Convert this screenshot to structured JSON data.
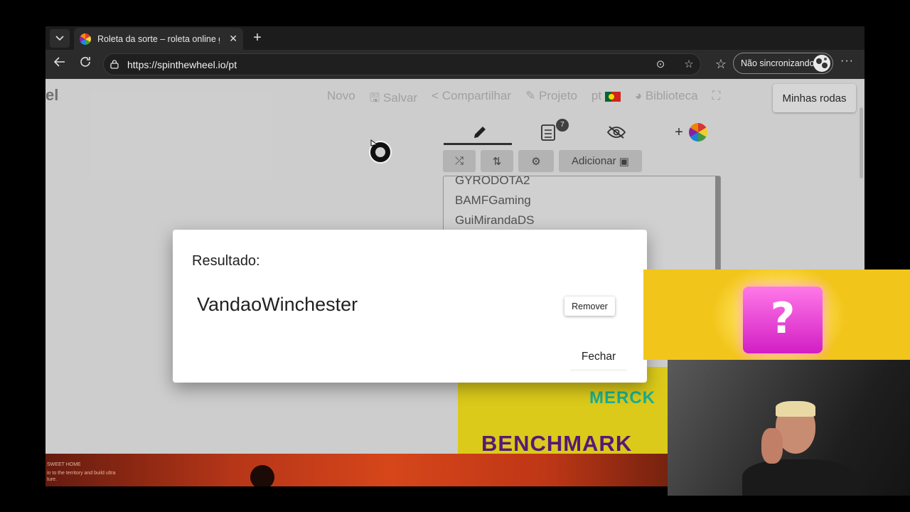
{
  "browser": {
    "tab_title": "Roleta da sorte – roleta online g",
    "url": "https://spinthewheel.io/pt",
    "sync_label": "Não sincronizando"
  },
  "site": {
    "logo_fragment": "el",
    "menu": {
      "novo": "Novo",
      "salvar": "Salvar",
      "compartilhar": "Compartilhar",
      "projeto": "Projeto",
      "lang": "pt",
      "biblioteca": "Biblioteca",
      "minhas_rodas": "Minhas rodas"
    },
    "entries_badge": "7",
    "add_image_label": "Adicionar",
    "entries": [
      "GYRODOTA2",
      "BAMFGaming",
      "GuiMirandaDS"
    ],
    "wheel_labels": [
      "MERCK",
      "BENCHMARK"
    ]
  },
  "stream_strip": {
    "lines": [
      "SWEET HOME",
      "in to the territory and build ultra",
      "ture."
    ]
  },
  "modal": {
    "title": "Resultado:",
    "winner": "VandaoWinchester",
    "remove_label": "Remover",
    "close_label": "Fechar"
  },
  "overlay": {
    "mystery_symbol": "?"
  },
  "colors": {
    "wheel_yellow": "#e7d51c",
    "overlay_yellow": "#f2c51b",
    "mystery_pink": "#d21ec4"
  }
}
